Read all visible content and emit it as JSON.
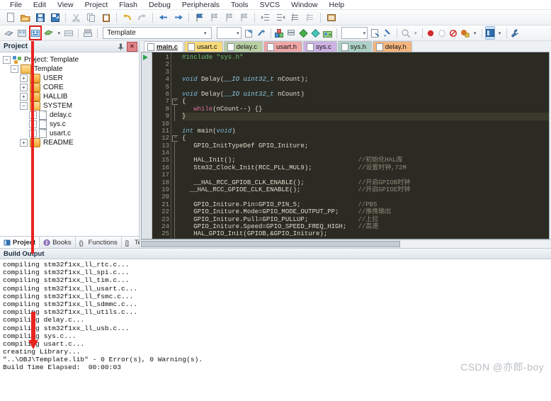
{
  "menu": {
    "items": [
      "File",
      "Edit",
      "View",
      "Project",
      "Flash",
      "Debug",
      "Peripherals",
      "Tools",
      "SVCS",
      "Window",
      "Help"
    ]
  },
  "toolbar1": {
    "buttons": [
      {
        "name": "new-file-button",
        "glyph": "὜B"
      },
      {
        "name": "open-file-button",
        "glyph": "Ὄ2"
      },
      {
        "name": "save-button",
        "glyph": "ὋE"
      },
      {
        "name": "save-all-button",
        "glyph": "὚B"
      },
      {
        "name": "cut-button",
        "glyph": "✂"
      },
      {
        "name": "copy-button",
        "glyph": "❐"
      },
      {
        "name": "paste-button",
        "glyph": "ὌB"
      },
      {
        "name": "undo-button",
        "glyph": "↶"
      },
      {
        "name": "redo-button",
        "glyph": "↷"
      },
      {
        "name": "navigate-back-button",
        "glyph": "←"
      },
      {
        "name": "navigate-forward-button",
        "glyph": "→"
      },
      {
        "name": "bookmark-toggle-button",
        "glyph": "⚑"
      },
      {
        "name": "bookmark-prev-button",
        "glyph": "⚐"
      },
      {
        "name": "bookmark-next-button",
        "glyph": "⚐"
      },
      {
        "name": "bookmark-clear-button",
        "glyph": "⚐"
      },
      {
        "name": "indent-right-button",
        "glyph": "⇥"
      },
      {
        "name": "indent-left-button",
        "glyph": "⇤"
      },
      {
        "name": "comment-button",
        "glyph": "≡"
      },
      {
        "name": "uncomment-button",
        "glyph": "≣"
      },
      {
        "name": "configure-editor-button",
        "glyph": "὜E"
      }
    ]
  },
  "toolbar2": {
    "buttons": [
      {
        "name": "translate-file-button",
        "glyph": "◈"
      },
      {
        "name": "build-target-button",
        "glyph": "▦"
      },
      {
        "name": "rebuild-all-button",
        "glyph": "▦",
        "highlighted": true
      },
      {
        "name": "batch-build-button",
        "glyph": "▧"
      },
      {
        "name": "stop-build-button",
        "glyph": "▤"
      },
      {
        "name": "download-button",
        "glyph": "⬇"
      }
    ],
    "target_select": {
      "value": "Template",
      "placeholder": "Template"
    },
    "right_buttons": [
      {
        "name": "target-options-button",
        "glyph": "὜2"
      },
      {
        "name": "manage-runtime-button",
        "glyph": "✦"
      },
      {
        "name": "pack-installer-button",
        "glyph": "◰"
      },
      {
        "name": "manage-project-items-button",
        "glyph": "◱"
      },
      {
        "name": "green-diamond-button",
        "glyph": "◆"
      },
      {
        "name": "cyan-diamond-button",
        "glyph": "◆"
      },
      {
        "name": "configure-flash-tools-button",
        "glyph": "▰"
      }
    ],
    "far_right_buttons": [
      {
        "name": "find-in-files-button",
        "glyph": "ὐD"
      },
      {
        "name": "insert-breakpoint-button",
        "glyph": "●"
      },
      {
        "name": "disable-breakpoint-button",
        "glyph": "○"
      },
      {
        "name": "kill-all-breakpoints-button",
        "glyph": "⬭"
      },
      {
        "name": "bookmarks-button",
        "glyph": "⚑"
      },
      {
        "name": "project-window-button",
        "glyph": "▤"
      },
      {
        "name": "configure-button",
        "glyph": "ὒ7"
      }
    ],
    "dropdown_value": ""
  },
  "project_pane": {
    "title": "Project",
    "pin_icon": "pin-icon",
    "close_icon": "close-icon",
    "tree": [
      {
        "label": "Project: Template",
        "depth": 0,
        "expander": "-",
        "icon": "project"
      },
      {
        "label": "Template",
        "depth": 1,
        "expander": "-",
        "icon": "folder-open"
      },
      {
        "label": "USER",
        "depth": 2,
        "expander": "+",
        "icon": "folder"
      },
      {
        "label": "CORE",
        "depth": 2,
        "expander": "+",
        "icon": "folder"
      },
      {
        "label": "HALLIB",
        "depth": 2,
        "expander": "+",
        "icon": "folder"
      },
      {
        "label": "SYSTEM",
        "depth": 2,
        "expander": "-",
        "icon": "folder-open"
      },
      {
        "label": "delay.c",
        "depth": 3,
        "expander": "+",
        "icon": "file"
      },
      {
        "label": "sys.c",
        "depth": 3,
        "expander": "+",
        "icon": "file"
      },
      {
        "label": "usart.c",
        "depth": 3,
        "expander": "+",
        "icon": "file"
      },
      {
        "label": "README",
        "depth": 2,
        "expander": "+",
        "icon": "folder"
      }
    ],
    "tabs": [
      {
        "label": "Project",
        "selected": true,
        "icon": "project-window-icon"
      },
      {
        "label": "Books",
        "selected": false,
        "icon": "books-icon"
      },
      {
        "label": "Functions",
        "selected": false,
        "icon": "functions-icon"
      },
      {
        "label": "Templates",
        "selected": false,
        "icon": "templates-icon"
      }
    ]
  },
  "editor": {
    "tabs": [
      {
        "label": "main.c",
        "selected": true,
        "color": "#ffffff"
      },
      {
        "label": "usart.c",
        "selected": false,
        "color": "#f7d97a"
      },
      {
        "label": "delay.c",
        "selected": false,
        "color": "#b9cfa3"
      },
      {
        "label": "usart.h",
        "selected": false,
        "color": "#f0a6a6"
      },
      {
        "label": "sys.c",
        "selected": false,
        "color": "#ceb2e3"
      },
      {
        "label": "sys.h",
        "selected": false,
        "color": "#acd0c5"
      },
      {
        "label": "delay.h",
        "selected": false,
        "color": "#f4b57e"
      }
    ],
    "lines": [
      {
        "n": 1,
        "code": "#include \"sys.h\"",
        "current": false
      },
      {
        "n": 2,
        "code": "",
        "current": false
      },
      {
        "n": 3,
        "code": "",
        "current": false
      },
      {
        "n": 4,
        "code": "void Delay(__IO uint32_t nCount);",
        "current": false
      },
      {
        "n": 5,
        "code": "",
        "current": false
      },
      {
        "n": 6,
        "code": "void Delay(__IO uint32_t nCount)",
        "current": false
      },
      {
        "n": 7,
        "code": "{",
        "current": false
      },
      {
        "n": 8,
        "code": "   while(nCount--) {}",
        "current": false
      },
      {
        "n": 9,
        "code": "}",
        "current": true
      },
      {
        "n": 10,
        "code": "",
        "current": false
      },
      {
        "n": 11,
        "code": "int main(void)",
        "current": false
      },
      {
        "n": 12,
        "code": "{",
        "current": false
      },
      {
        "n": 13,
        "code": "   GPIO_InitTypeDef GPIO_Initure;",
        "current": false
      },
      {
        "n": 14,
        "code": "",
        "current": false
      },
      {
        "n": 15,
        "code": "   HAL_Init();",
        "comment": "//初始化HAL库",
        "current": false
      },
      {
        "n": 16,
        "code": "   Stm32_Clock_Init(RCC_PLL_MUL9);",
        "comment": "//设置时钟,72M",
        "current": false
      },
      {
        "n": 17,
        "code": "",
        "current": false
      },
      {
        "n": 18,
        "code": "   __HAL_RCC_GPIOB_CLK_ENABLE();",
        "comment": "//开启GPIOB时钟",
        "current": false
      },
      {
        "n": 19,
        "code": "  __HAL_RCC_GPIOE_CLK_ENABLE();",
        "comment": "//开启GPIOE时钟",
        "current": false
      },
      {
        "n": 20,
        "code": "",
        "current": false
      },
      {
        "n": 21,
        "code": "   GPIO_Initure.Pin=GPIO_PIN_5;",
        "comment": "//PB5",
        "current": false
      },
      {
        "n": 22,
        "code": "   GPIO_Initure.Mode=GPIO_MODE_OUTPUT_PP;",
        "comment": "//推挽输出",
        "current": false
      },
      {
        "n": 23,
        "code": "   GPIO_Initure.Pull=GPIO_PULLUP;",
        "comment": "//上拉",
        "current": false
      },
      {
        "n": 24,
        "code": "   GPIO_Initure.Speed=GPIO_SPEED_FREQ_HIGH;",
        "comment": "//高速",
        "current": false
      },
      {
        "n": 25,
        "code": "   HAL_GPIO_Init(GPIOB,&GPIO_Initure);",
        "current": false
      }
    ]
  },
  "build_output": {
    "title": "Build Output",
    "lines": [
      {
        "text": "compiling stm32f1xx_ll_rtc.c...",
        "boxed": false
      },
      {
        "text": "compiling stm32f1xx_ll_spi.c...",
        "boxed": false
      },
      {
        "text": "compiling stm32f1xx_ll_tim.c...",
        "boxed": false
      },
      {
        "text": "compiling stm32f1xx_ll_usart.c...",
        "boxed": false
      },
      {
        "text": "compiling stm32f1xx_ll_fsmc.c...",
        "boxed": false
      },
      {
        "text": "compiling stm32f1xx_ll_sdmmc.c...",
        "boxed": false
      },
      {
        "text": "compiling stm32f1xx_ll_utils.c...",
        "boxed": false
      },
      {
        "text": "compiling delay.c...",
        "boxed": false
      },
      {
        "text": "compiling stm32f1xx_ll_usb.c...",
        "boxed": false
      },
      {
        "text": "compiling sys.c...",
        "boxed": false
      },
      {
        "text": "compiling usart.c...",
        "boxed": false
      },
      {
        "text": "creating Library...",
        "boxed": true
      },
      {
        "text": "\"..\\OBJ\\Template.lib\" - 0 Error(s), 0 Warning(s).",
        "boxed": false
      },
      {
        "text": "Build Time Elapsed:  00:00:03",
        "boxed": false
      }
    ]
  },
  "watermark": {
    "text": "CSDN @亦郎-boy"
  },
  "colors": {
    "annotation_red": "#e8251f",
    "editor_background": "#2b2b23",
    "chrome": "#eef1f4"
  }
}
